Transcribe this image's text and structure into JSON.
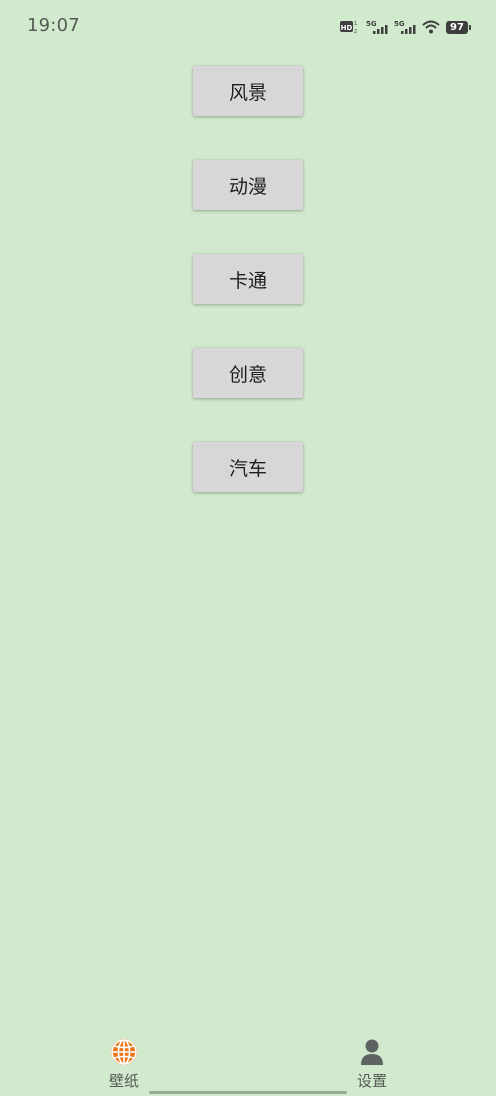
{
  "status_bar": {
    "time": "19:07",
    "battery": "97",
    "network_labels": [
      "HD",
      "5G",
      "5G"
    ]
  },
  "categories": [
    {
      "label": "风景"
    },
    {
      "label": "动漫"
    },
    {
      "label": "卡通"
    },
    {
      "label": "创意"
    },
    {
      "label": "汽车"
    }
  ],
  "bottom_nav": {
    "tabs": [
      {
        "label": "壁纸",
        "icon": "globe-icon",
        "active": true,
        "color": "#e8791e"
      },
      {
        "label": "设置",
        "icon": "person-icon",
        "active": false,
        "color": "#5e6362"
      }
    ]
  },
  "colors": {
    "background": "#d1e9cc",
    "button": "#d7d7d7",
    "accent": "#e8791e"
  }
}
